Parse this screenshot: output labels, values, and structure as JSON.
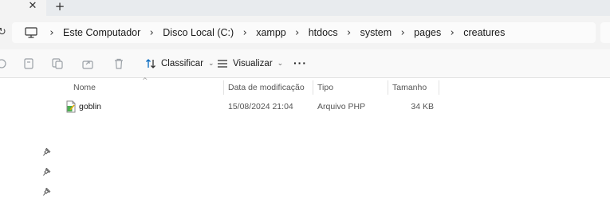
{
  "tabstrip": {
    "close_icon": "close-icon",
    "new_tab_icon": "plus-icon"
  },
  "address": {
    "pc_icon": "computer-icon",
    "crumbs": [
      "Este Computador",
      "Disco Local (C:)",
      "xampp",
      "htdocs",
      "system",
      "pages",
      "creatures"
    ]
  },
  "command_bar": {
    "icons": [
      "cut-icon",
      "copy-icon",
      "paste-icon",
      "share-icon",
      "delete-icon"
    ],
    "sort_label": "Classificar",
    "view_label": "Visualizar",
    "more_label": "···"
  },
  "columns": {
    "name": "Nome",
    "modified": "Data de modificação",
    "type": "Tipo",
    "size": "Tamanho"
  },
  "files": [
    {
      "name": "goblin",
      "modified": "15/08/2024 21:04",
      "type": "Arquivo PHP",
      "size": "34 KB",
      "icon": "php-file-icon"
    }
  ],
  "navigation_pane": {
    "pin_icon": "pin-icon",
    "pinned_count": 3
  },
  "colors": {
    "accent": "#0067c0",
    "tabstrip_bg": "#e8ebee",
    "toolbar_bg": "#f3f3f3"
  }
}
